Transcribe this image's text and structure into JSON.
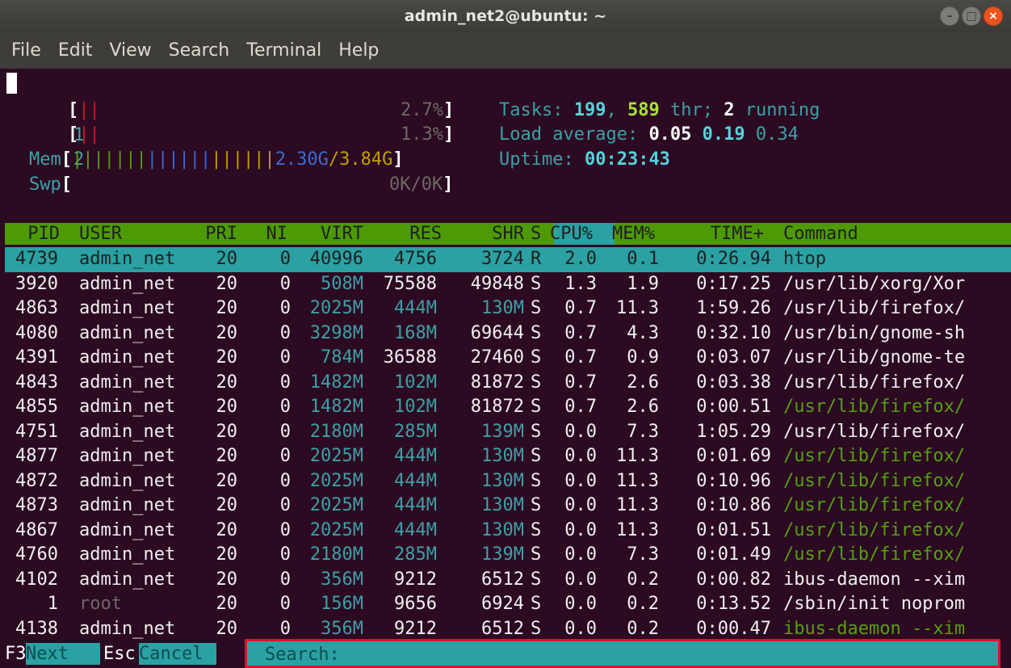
{
  "window": {
    "title": "admin_net2@ubuntu: ~",
    "buttons": [
      "–",
      "□",
      "×"
    ]
  },
  "menu": [
    "File",
    "Edit",
    "View",
    "Search",
    "Terminal",
    "Help"
  ],
  "meters": {
    "cpu1": {
      "label": "1",
      "bar": "||",
      "value": "2.7%",
      "fraction": 0.027
    },
    "cpu2": {
      "label": "2",
      "bar": "||",
      "value": "1.3%",
      "fraction": 0.013
    },
    "mem": {
      "label": "Mem",
      "bar": "|||||||||||||||||||",
      "used": "2.30G",
      "total": "3.84G",
      "sep": "/"
    },
    "swp": {
      "label": "Swp",
      "value": "0K/0K"
    }
  },
  "summary": {
    "tasks_label": "Tasks: ",
    "tasks": "199",
    "comma": ", ",
    "threads": "589",
    "thr_label": " thr; ",
    "running": "2",
    "running_label": " running",
    "load_label": "Load average: ",
    "load1": "0.05",
    "load5": "0.19",
    "load15": "0.34",
    "uptime_label": "Uptime: ",
    "uptime": "00:23:43"
  },
  "columns": [
    "PID",
    "USER",
    "PRI",
    "NI",
    "VIRT",
    "RES",
    "SHR",
    "S",
    "CPU%",
    "MEM%",
    "TIME+",
    "Command"
  ],
  "processes": [
    {
      "pid": "4739",
      "user": "admin_net",
      "pri": "20",
      "ni": "0",
      "virt": "40996",
      "res": "4756",
      "shr": "3724",
      "s": "R",
      "cpu": "2.0",
      "mem": "0.1",
      "time": "0:26.94",
      "cmd": "htop"
    },
    {
      "pid": "3920",
      "user": "admin_net",
      "pri": "20",
      "ni": "0",
      "virt": "508M",
      "res": "75588",
      "shr": "49848",
      "s": "S",
      "cpu": "1.3",
      "mem": "1.9",
      "time": "0:17.25",
      "cmd": "/usr/lib/xorg/Xor"
    },
    {
      "pid": "4863",
      "user": "admin_net",
      "pri": "20",
      "ni": "0",
      "virt": "2025M",
      "res": "444M",
      "shr": "130M",
      "s": "S",
      "cpu": "0.7",
      "mem": "11.3",
      "time": "1:59.26",
      "cmd": "/usr/lib/firefox/"
    },
    {
      "pid": "4080",
      "user": "admin_net",
      "pri": "20",
      "ni": "0",
      "virt": "3298M",
      "res": "168M",
      "shr": "69644",
      "s": "S",
      "cpu": "0.7",
      "mem": "4.3",
      "time": "0:32.10",
      "cmd": "/usr/bin/gnome-sh"
    },
    {
      "pid": "4391",
      "user": "admin_net",
      "pri": "20",
      "ni": "0",
      "virt": "784M",
      "res": "36588",
      "shr": "27460",
      "s": "S",
      "cpu": "0.7",
      "mem": "0.9",
      "time": "0:03.07",
      "cmd": "/usr/lib/gnome-te"
    },
    {
      "pid": "4843",
      "user": "admin_net",
      "pri": "20",
      "ni": "0",
      "virt": "1482M",
      "res": "102M",
      "shr": "81872",
      "s": "S",
      "cpu": "0.7",
      "mem": "2.6",
      "time": "0:03.38",
      "cmd": "/usr/lib/firefox/"
    },
    {
      "pid": "4855",
      "user": "admin_net",
      "pri": "20",
      "ni": "0",
      "virt": "1482M",
      "res": "102M",
      "shr": "81872",
      "s": "S",
      "cpu": "0.7",
      "mem": "2.6",
      "time": "0:00.51",
      "cmd": "/usr/lib/firefox/"
    },
    {
      "pid": "4751",
      "user": "admin_net",
      "pri": "20",
      "ni": "0",
      "virt": "2180M",
      "res": "285M",
      "shr": "139M",
      "s": "S",
      "cpu": "0.0",
      "mem": "7.3",
      "time": "1:05.29",
      "cmd": "/usr/lib/firefox/"
    },
    {
      "pid": "4877",
      "user": "admin_net",
      "pri": "20",
      "ni": "0",
      "virt": "2025M",
      "res": "444M",
      "shr": "130M",
      "s": "S",
      "cpu": "0.0",
      "mem": "11.3",
      "time": "0:01.69",
      "cmd": "/usr/lib/firefox/"
    },
    {
      "pid": "4872",
      "user": "admin_net",
      "pri": "20",
      "ni": "0",
      "virt": "2025M",
      "res": "444M",
      "shr": "130M",
      "s": "S",
      "cpu": "0.0",
      "mem": "11.3",
      "time": "0:10.96",
      "cmd": "/usr/lib/firefox/"
    },
    {
      "pid": "4873",
      "user": "admin_net",
      "pri": "20",
      "ni": "0",
      "virt": "2025M",
      "res": "444M",
      "shr": "130M",
      "s": "S",
      "cpu": "0.0",
      "mem": "11.3",
      "time": "0:10.86",
      "cmd": "/usr/lib/firefox/"
    },
    {
      "pid": "4867",
      "user": "admin_net",
      "pri": "20",
      "ni": "0",
      "virt": "2025M",
      "res": "444M",
      "shr": "130M",
      "s": "S",
      "cpu": "0.0",
      "mem": "11.3",
      "time": "0:01.51",
      "cmd": "/usr/lib/firefox/"
    },
    {
      "pid": "4760",
      "user": "admin_net",
      "pri": "20",
      "ni": "0",
      "virt": "2180M",
      "res": "285M",
      "shr": "139M",
      "s": "S",
      "cpu": "0.0",
      "mem": "7.3",
      "time": "0:01.49",
      "cmd": "/usr/lib/firefox/"
    },
    {
      "pid": "4102",
      "user": "admin_net",
      "pri": "20",
      "ni": "0",
      "virt": "356M",
      "res": "9212",
      "shr": "6512",
      "s": "S",
      "cpu": "0.0",
      "mem": "0.2",
      "time": "0:00.82",
      "cmd": "ibus-daemon --xim"
    },
    {
      "pid": "1",
      "user": "root",
      "pri": "20",
      "ni": "0",
      "virt": "156M",
      "res": "9656",
      "shr": "6924",
      "s": "S",
      "cpu": "0.0",
      "mem": "0.2",
      "time": "0:13.52",
      "cmd": "/sbin/init noprom"
    },
    {
      "pid": "4138",
      "user": "admin_net",
      "pri": "20",
      "ni": "0",
      "virt": "356M",
      "res": "9212",
      "shr": "6512",
      "s": "S",
      "cpu": "0.0",
      "mem": "0.2",
      "time": "0:00.47",
      "cmd": "ibus-daemon --xim"
    }
  ],
  "footer": {
    "next_key": "F3",
    "next_label": "Next",
    "cancel_key": "Esc",
    "cancel_label": "Cancel",
    "search_label": "Search: "
  },
  "colors": {
    "background": "#2c0a22",
    "header": "#4e9a06",
    "selection": "#2aa1a3",
    "search_border": "#e0102a"
  }
}
